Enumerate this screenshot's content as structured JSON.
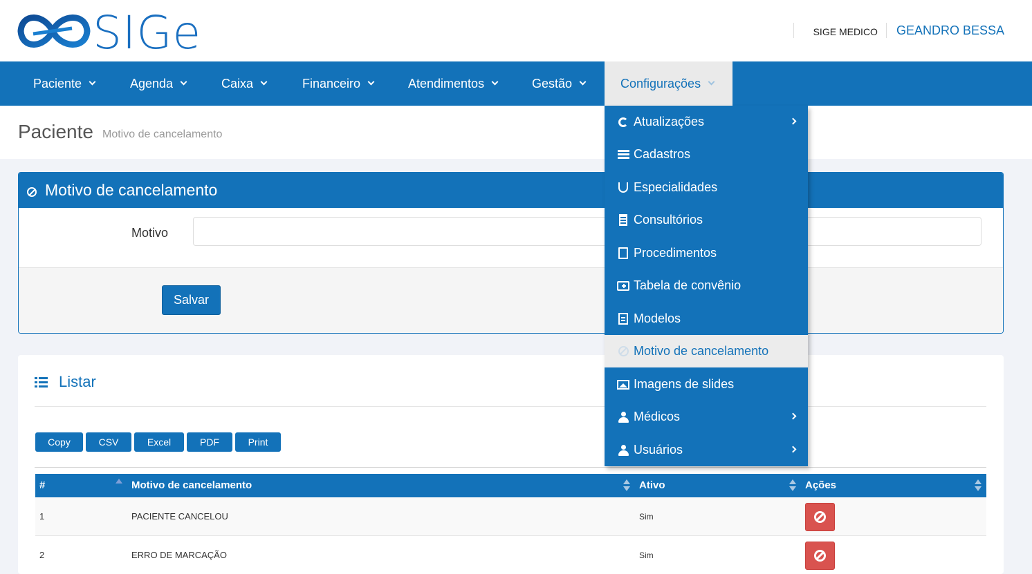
{
  "brand": {
    "logo_text": "SIGe",
    "primary_color": "#1372b9"
  },
  "header": {
    "company": "SIGE MEDICO",
    "user": "GEANDRO BESSA"
  },
  "nav": {
    "items": [
      {
        "label": "Paciente"
      },
      {
        "label": "Agenda"
      },
      {
        "label": "Caixa"
      },
      {
        "label": "Financeiro"
      },
      {
        "label": "Atendimentos"
      },
      {
        "label": "Gestão"
      },
      {
        "label": "Configurações",
        "active": true
      }
    ]
  },
  "page": {
    "title": "Paciente",
    "subtitle": "Motivo de cancelamento"
  },
  "form": {
    "title": "Motivo de cancelamento",
    "field_label": "Motivo",
    "field_value": "",
    "save_label": "Salvar"
  },
  "list": {
    "title": "Listar",
    "export_buttons": [
      "Copy",
      "CSV",
      "Excel",
      "PDF",
      "Print"
    ],
    "columns": [
      "#",
      "Motivo de cancelamento",
      "Ativo",
      "Ações"
    ],
    "rows": [
      {
        "id": "1",
        "motivo": "PACIENTE CANCELOU",
        "ativo": "Sim"
      },
      {
        "id": "2",
        "motivo": "ERRO DE MARCAÇÃO",
        "ativo": "Sim"
      }
    ]
  },
  "dropdown": {
    "items": [
      {
        "label": "Atualizações",
        "icon": "refresh-icon",
        "submenu": true
      },
      {
        "label": "Cadastros",
        "icon": "list-icon"
      },
      {
        "label": "Especialidades",
        "icon": "stethoscope-icon"
      },
      {
        "label": "Consultórios",
        "icon": "building-icon"
      },
      {
        "label": "Procedimentos",
        "icon": "document-p-icon"
      },
      {
        "label": "Tabela de convênio",
        "icon": "medkit-icon"
      },
      {
        "label": "Modelos",
        "icon": "document-icon"
      },
      {
        "label": "Motivo de cancelamento",
        "icon": "ban-icon",
        "active": true
      },
      {
        "label": "Imagens de slides",
        "icon": "image-icon"
      },
      {
        "label": "Médicos",
        "icon": "doctor-icon",
        "submenu": true
      },
      {
        "label": "Usuários",
        "icon": "user-icon",
        "submenu": true
      }
    ]
  }
}
